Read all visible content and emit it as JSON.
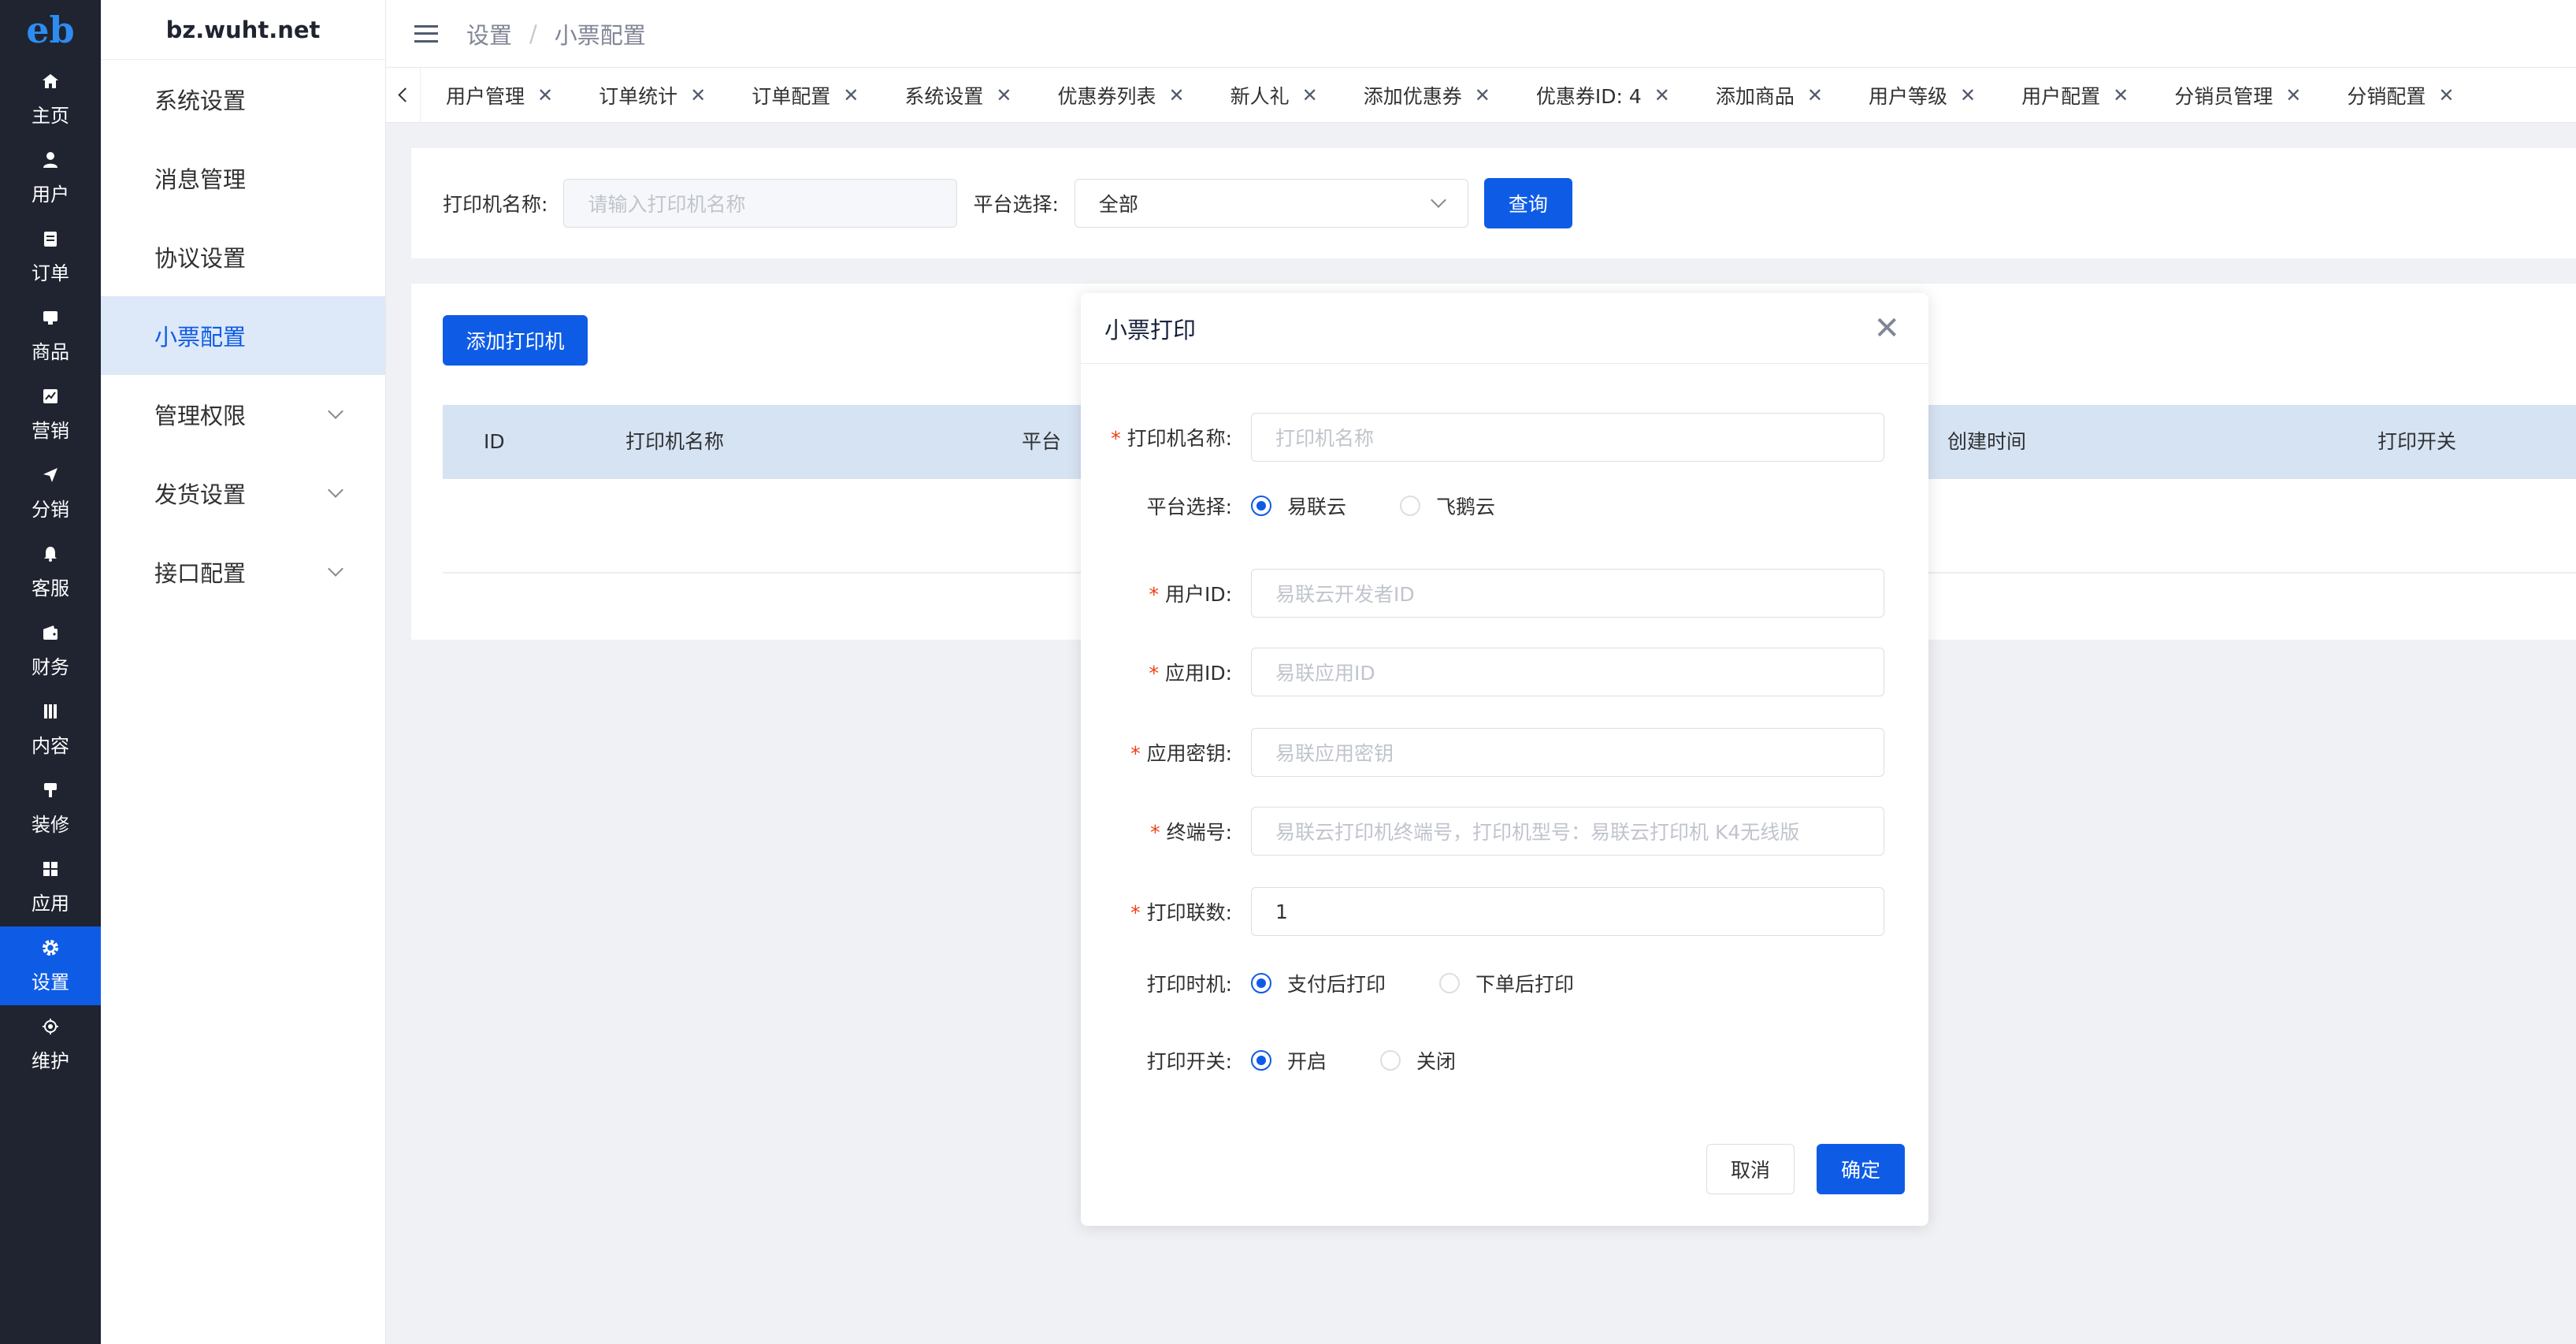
{
  "rail": {
    "logo": "eb",
    "items": [
      {
        "label": "主页",
        "icon": "home-icon"
      },
      {
        "label": "用户",
        "icon": "user-icon"
      },
      {
        "label": "订单",
        "icon": "order-icon"
      },
      {
        "label": "商品",
        "icon": "product-icon"
      },
      {
        "label": "营销",
        "icon": "marketing-icon"
      },
      {
        "label": "分销",
        "icon": "distribution-icon"
      },
      {
        "label": "客服",
        "icon": "bell-icon"
      },
      {
        "label": "财务",
        "icon": "wallet-icon"
      },
      {
        "label": "内容",
        "icon": "content-icon"
      },
      {
        "label": "装修",
        "icon": "brush-icon"
      },
      {
        "label": "应用",
        "icon": "apps-icon"
      },
      {
        "label": "设置",
        "icon": "gear-icon"
      },
      {
        "label": "维护",
        "icon": "maintenance-icon"
      }
    ]
  },
  "submenu": {
    "site": "bz.wuht.net",
    "items": [
      {
        "label": "系统设置"
      },
      {
        "label": "消息管理"
      },
      {
        "label": "协议设置"
      },
      {
        "label": "小票配置"
      },
      {
        "label": "管理权限"
      },
      {
        "label": "发货设置"
      },
      {
        "label": "接口配置"
      }
    ]
  },
  "header": {
    "breadcrumb": [
      "设置",
      "小票配置"
    ],
    "separator": "/"
  },
  "tabs": [
    "用户管理",
    "订单统计",
    "订单配置",
    "系统设置",
    "优惠券列表",
    "新人礼",
    "添加优惠券",
    "优惠券ID: 4",
    "添加商品",
    "用户等级",
    "用户配置",
    "分销员管理",
    "分销配置"
  ],
  "search": {
    "name_label": "打印机名称:",
    "name_placeholder": "请输入打印机名称",
    "platform_label": "平台选择:",
    "platform_value": "全部",
    "query_button": "查询"
  },
  "content": {
    "add_button": "添加打印机",
    "columns": [
      "ID",
      "打印机名称",
      "平台",
      "创建时间",
      "打印开关"
    ]
  },
  "dialog": {
    "title": "小票打印",
    "fields": {
      "printer_name": {
        "label": "打印机名称:",
        "placeholder": "打印机名称"
      },
      "platform": {
        "label": "平台选择:",
        "options": [
          "易联云",
          "飞鹅云"
        ]
      },
      "user_id": {
        "label": "用户ID:",
        "placeholder": "易联云开发者ID"
      },
      "app_id": {
        "label": "应用ID:",
        "placeholder": "易联应用ID"
      },
      "app_secret": {
        "label": "应用密钥:",
        "placeholder": "易联应用密钥"
      },
      "terminal": {
        "label": "终端号:",
        "placeholder": "易联云打印机终端号，打印机型号：易联云打印机 K4无线版"
      },
      "copies": {
        "label": "打印联数:",
        "value": "1"
      },
      "print_time": {
        "label": "打印时机:",
        "options": [
          "支付后打印",
          "下单后打印"
        ]
      },
      "print_switch": {
        "label": "打印开关:",
        "options": [
          "开启",
          "关闭"
        ]
      }
    },
    "cancel": "取消",
    "confirm": "确定"
  },
  "colors": {
    "primary": "#0e5ce6",
    "rail_bg": "#1f2430",
    "required": "#ed4014"
  }
}
